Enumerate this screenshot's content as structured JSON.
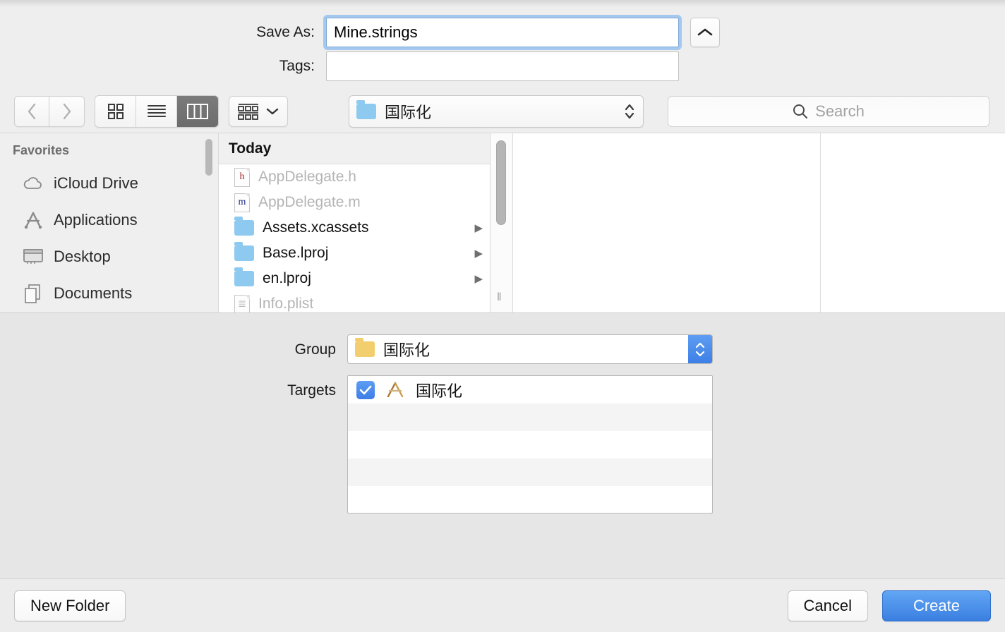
{
  "save_panel": {
    "name_field": {
      "label": "Save As:",
      "value": "Mine.strings",
      "expand_icon": "chevron-up-icon"
    },
    "tags_field": {
      "label": "Tags:",
      "value": "",
      "placeholder": ""
    }
  },
  "toolbar": {
    "back_icon": "chevron-left-icon",
    "forward_icon": "chevron-right-icon",
    "view_modes": [
      {
        "name": "icon-view",
        "icon": "grid-icon",
        "selected": false
      },
      {
        "name": "list-view",
        "icon": "list-icon",
        "selected": false
      },
      {
        "name": "column-view",
        "icon": "columns-icon",
        "selected": true
      }
    ],
    "arrange": {
      "icon": "arrange-icon",
      "chevron": "chevron-down-icon"
    },
    "path_popup": {
      "icon": "folder-icon",
      "label": "国际化",
      "stepper": "up-down-arrows-icon"
    },
    "search": {
      "icon": "search-icon",
      "placeholder": "Search",
      "value": ""
    }
  },
  "sidebar": {
    "header": "Favorites",
    "items": [
      {
        "label": "iCloud Drive",
        "icon": "cloud-icon"
      },
      {
        "label": "Applications",
        "icon": "applications-icon"
      },
      {
        "label": "Desktop",
        "icon": "desktop-icon"
      },
      {
        "label": "Documents",
        "icon": "documents-icon"
      }
    ]
  },
  "file_browser": {
    "column_header": "Today",
    "files": [
      {
        "name": "AppDelegate.h",
        "icon": "h-file-icon",
        "glyph": "h",
        "dimmed": true,
        "has_children": false
      },
      {
        "name": "AppDelegate.m",
        "icon": "m-file-icon",
        "glyph": "m",
        "dimmed": true,
        "has_children": false
      },
      {
        "name": "Assets.xcassets",
        "icon": "folder-icon",
        "glyph": "",
        "dimmed": false,
        "has_children": true
      },
      {
        "name": "Base.lproj",
        "icon": "folder-icon",
        "glyph": "",
        "dimmed": false,
        "has_children": true
      },
      {
        "name": "en.lproj",
        "icon": "folder-icon",
        "glyph": "",
        "dimmed": false,
        "has_children": true
      },
      {
        "name": "Info.plist",
        "icon": "plist-file-icon",
        "glyph": "≣",
        "dimmed": true,
        "has_children": false
      }
    ],
    "disclosure_icon": "triangle-right-icon",
    "scrollbar_grip_icon": "resize-grip-icon"
  },
  "accessory": {
    "group": {
      "label": "Group",
      "icon": "folder-icon",
      "value": "国际化",
      "stepper": "up-down-arrows-icon"
    },
    "targets": {
      "label": "Targets",
      "rows": [
        {
          "name": "国际化",
          "icon": "xcode-target-icon",
          "checked": true
        }
      ],
      "empty_row_count": 4
    }
  },
  "footer": {
    "new_folder": "New Folder",
    "cancel": "Cancel",
    "create": "Create"
  },
  "colors": {
    "accent_blue": "#3a7fe0",
    "focus_ring": "#a5c8ef",
    "panel_bg": "#e6e6e6",
    "top_bg": "#eeeeee"
  }
}
